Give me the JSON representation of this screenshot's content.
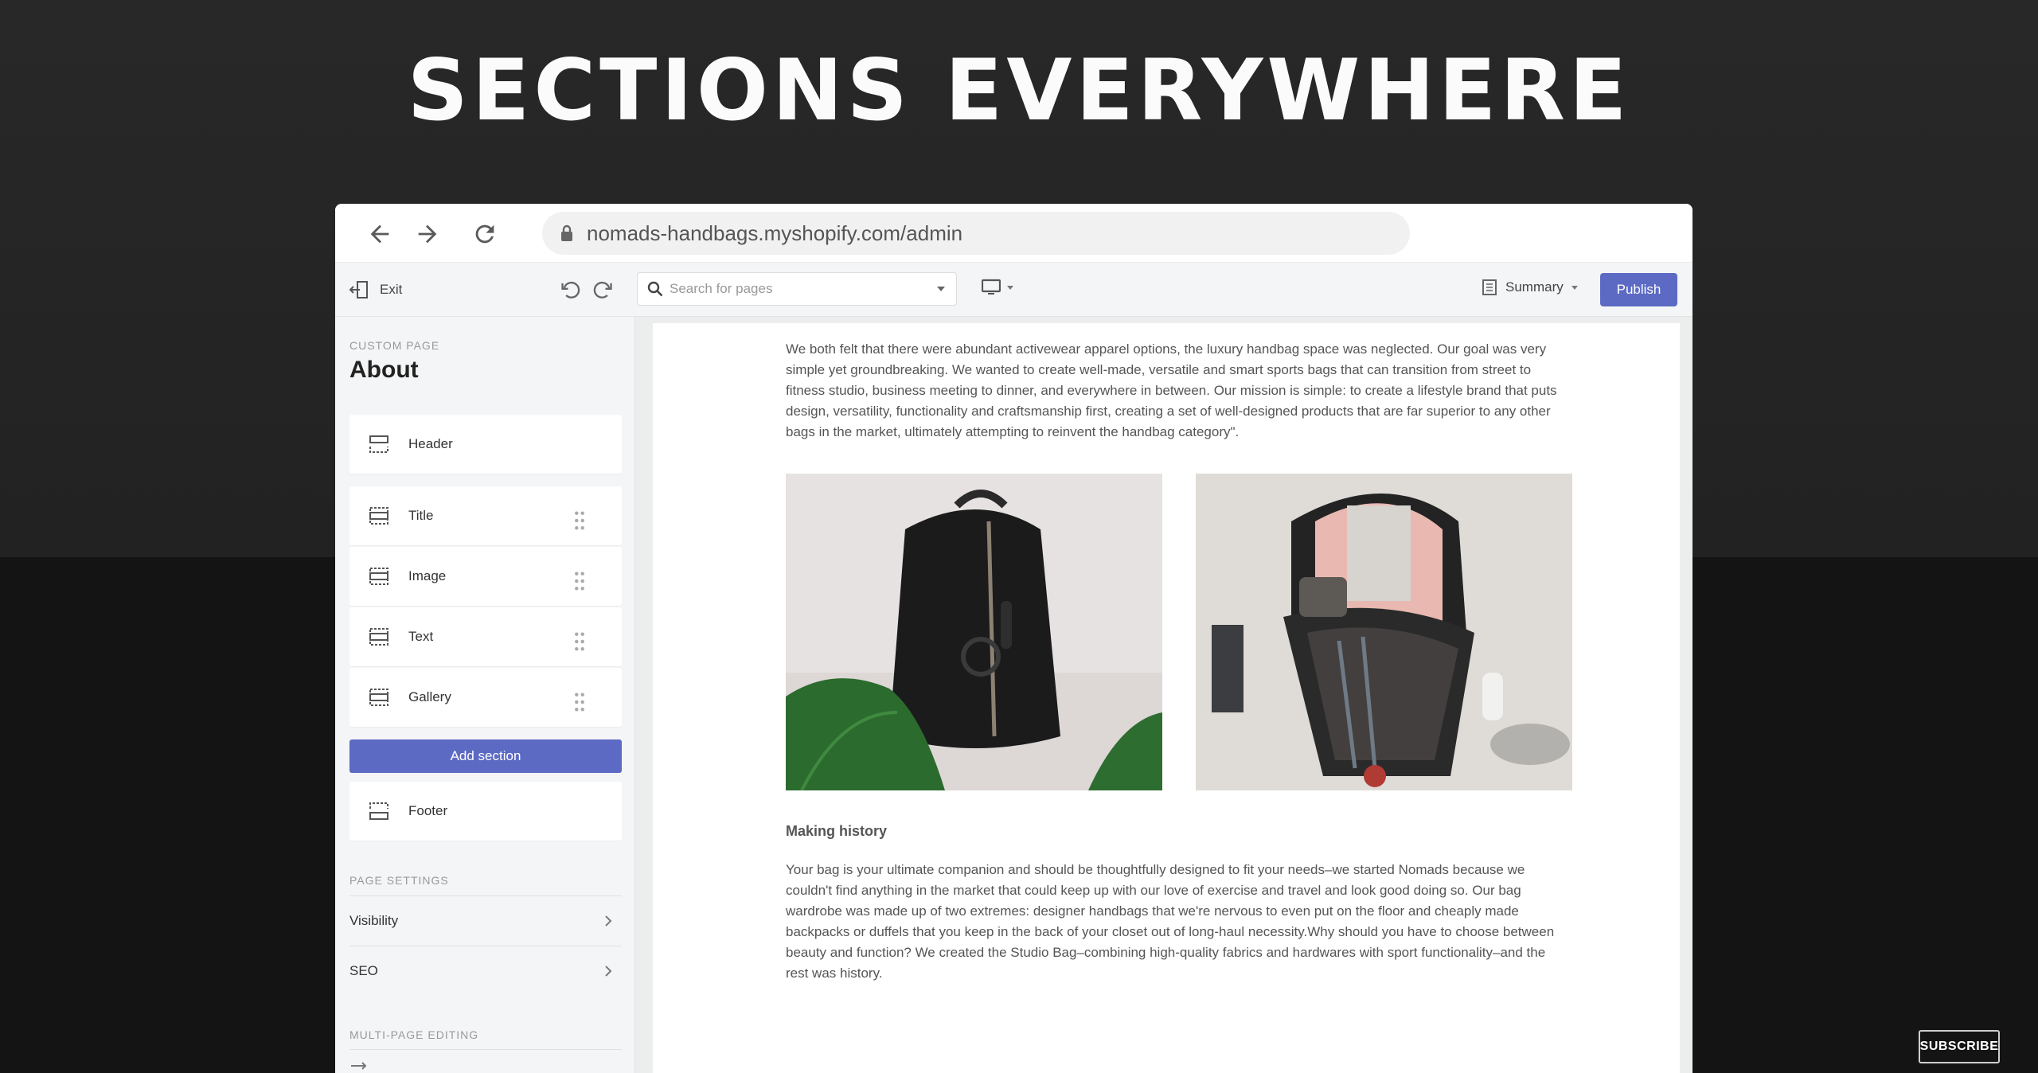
{
  "headline": "SECTIONS EVERYWHERE",
  "browser": {
    "url": "nomads-handbags.myshopify.com/admin"
  },
  "toolbar": {
    "exit_label": "Exit",
    "search_placeholder": "Search for pages",
    "summary_label": "Summary",
    "publish_label": "Publish"
  },
  "sidebar": {
    "eyebrow": "CUSTOM PAGE",
    "page_title": "About",
    "sections": [
      {
        "label": "Header",
        "icon": "section-header-icon"
      },
      {
        "label": "Title",
        "icon": "section-icon"
      },
      {
        "label": "Image",
        "icon": "section-icon"
      },
      {
        "label": "Text",
        "icon": "section-icon"
      },
      {
        "label": "Gallery",
        "icon": "section-icon"
      },
      {
        "label": "Footer",
        "icon": "section-footer-icon"
      }
    ],
    "add_section_label": "Add section",
    "page_settings_heading": "PAGE SETTINGS",
    "settings": [
      {
        "label": "Visibility"
      },
      {
        "label": "SEO"
      }
    ],
    "multi_page_heading": "MULTI-PAGE EDITING"
  },
  "preview": {
    "intro_text": "We both felt that there were abundant activewear apparel options, the luxury handbag space was neglected. Our goal was very simple yet groundbreaking. We wanted to create well-made, versatile and smart sports bags that can transition from street to fitness studio, business meeting to dinner, and everywhere in between. Our mission is simple: to create a lifestyle brand that puts design, versatility, functionality and craftsmanship first, creating a set of well-designed products that are far superior to any other bags in the market, ultimately attempting to reinvent the handbag category\".",
    "subheading": "Making history",
    "body_text": "Your bag is your ultimate companion and should be thoughtfully designed to fit your needs–we started Nomads because we couldn't find anything in the market that could keep up with our love of exercise and travel and look good doing so. Our bag wardrobe was made up of two extremes: designer handbags that we're nervous to even put on the floor and cheaply made backpacks or duffels that you keep in the back of your closet out of long-haul necessity.Why should you have to choose between beauty and function? We created the Studio Bag–combining high-quality fabrics and hardwares with sport functionality–and the rest was history."
  },
  "subscribe_label": "SUBSCRIBE",
  "colors": {
    "accent": "#5c6ac4",
    "background": "#141414"
  }
}
